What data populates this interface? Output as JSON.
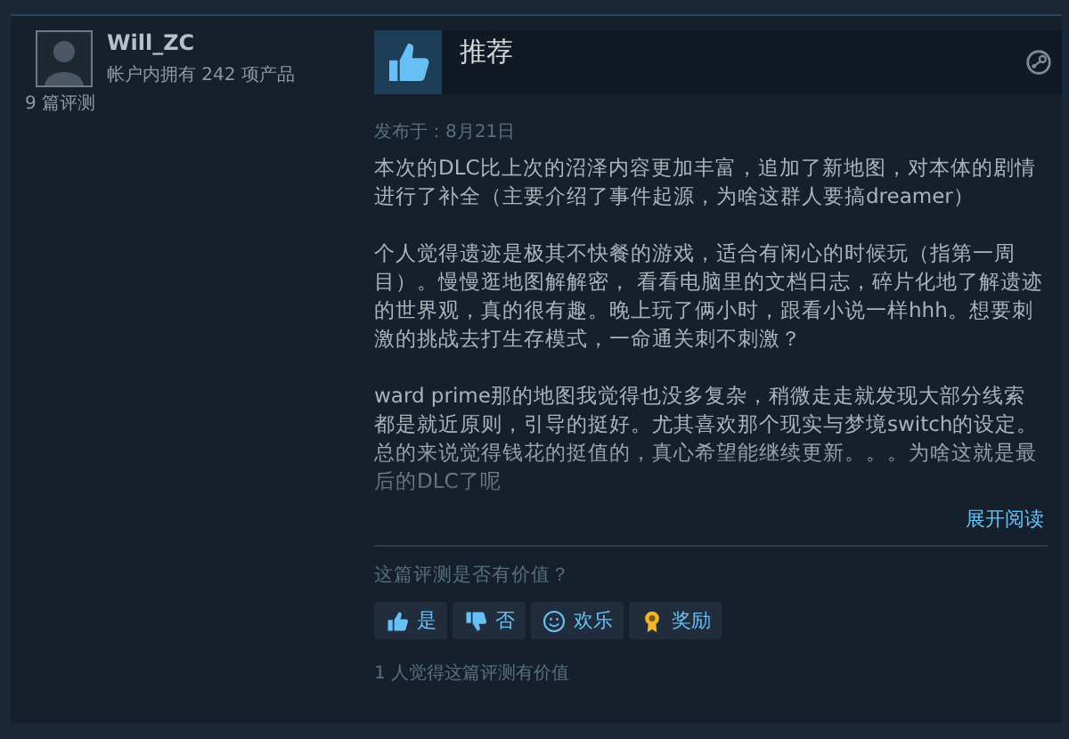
{
  "reviewer": {
    "name": "Will_ZC",
    "products_owned": "帐户内拥有 242 项产品",
    "review_count": "9 篇评测"
  },
  "review": {
    "verdict": "推荐",
    "recommended": true,
    "posted": "发布于：8月21日",
    "paragraphs": [
      "本次的DLC比上次的沼泽内容更加丰富，追加了新地图，对本体的剧情进行了补全（主要介绍了事件起源，为啥这群人要搞dreamer）",
      "个人觉得遗迹是极其不快餐的游戏，适合有闲心的时候玩（指第一周目）。慢慢逛地图解解密， 看看电脑里的文档日志，碎片化地了解遗迹的世界观，真的很有趣。晚上玩了俩小时，跟看小说一样hhh。想要刺激的挑战去打生存模式，一命通关刺不刺激？",
      "ward prime那的地图我觉得也没多复杂，稍微走走就发现大部分线索都是就近原则，引导的挺好。尤其喜欢那个现实与梦境switch的设定。总的来说觉得钱花的挺值的，真心希望能继续更新。。。为啥这就是最后的DLC了呢"
    ],
    "expand_link": "展开阅读"
  },
  "helpful": {
    "question": "这篇评测是否有价值？",
    "buttons": [
      {
        "kind": "yes",
        "label": "是"
      },
      {
        "kind": "no",
        "label": "否"
      },
      {
        "kind": "funny",
        "label": "欢乐"
      },
      {
        "kind": "award",
        "label": "奖励"
      }
    ],
    "summary": "1 人觉得这篇评测有价值"
  }
}
